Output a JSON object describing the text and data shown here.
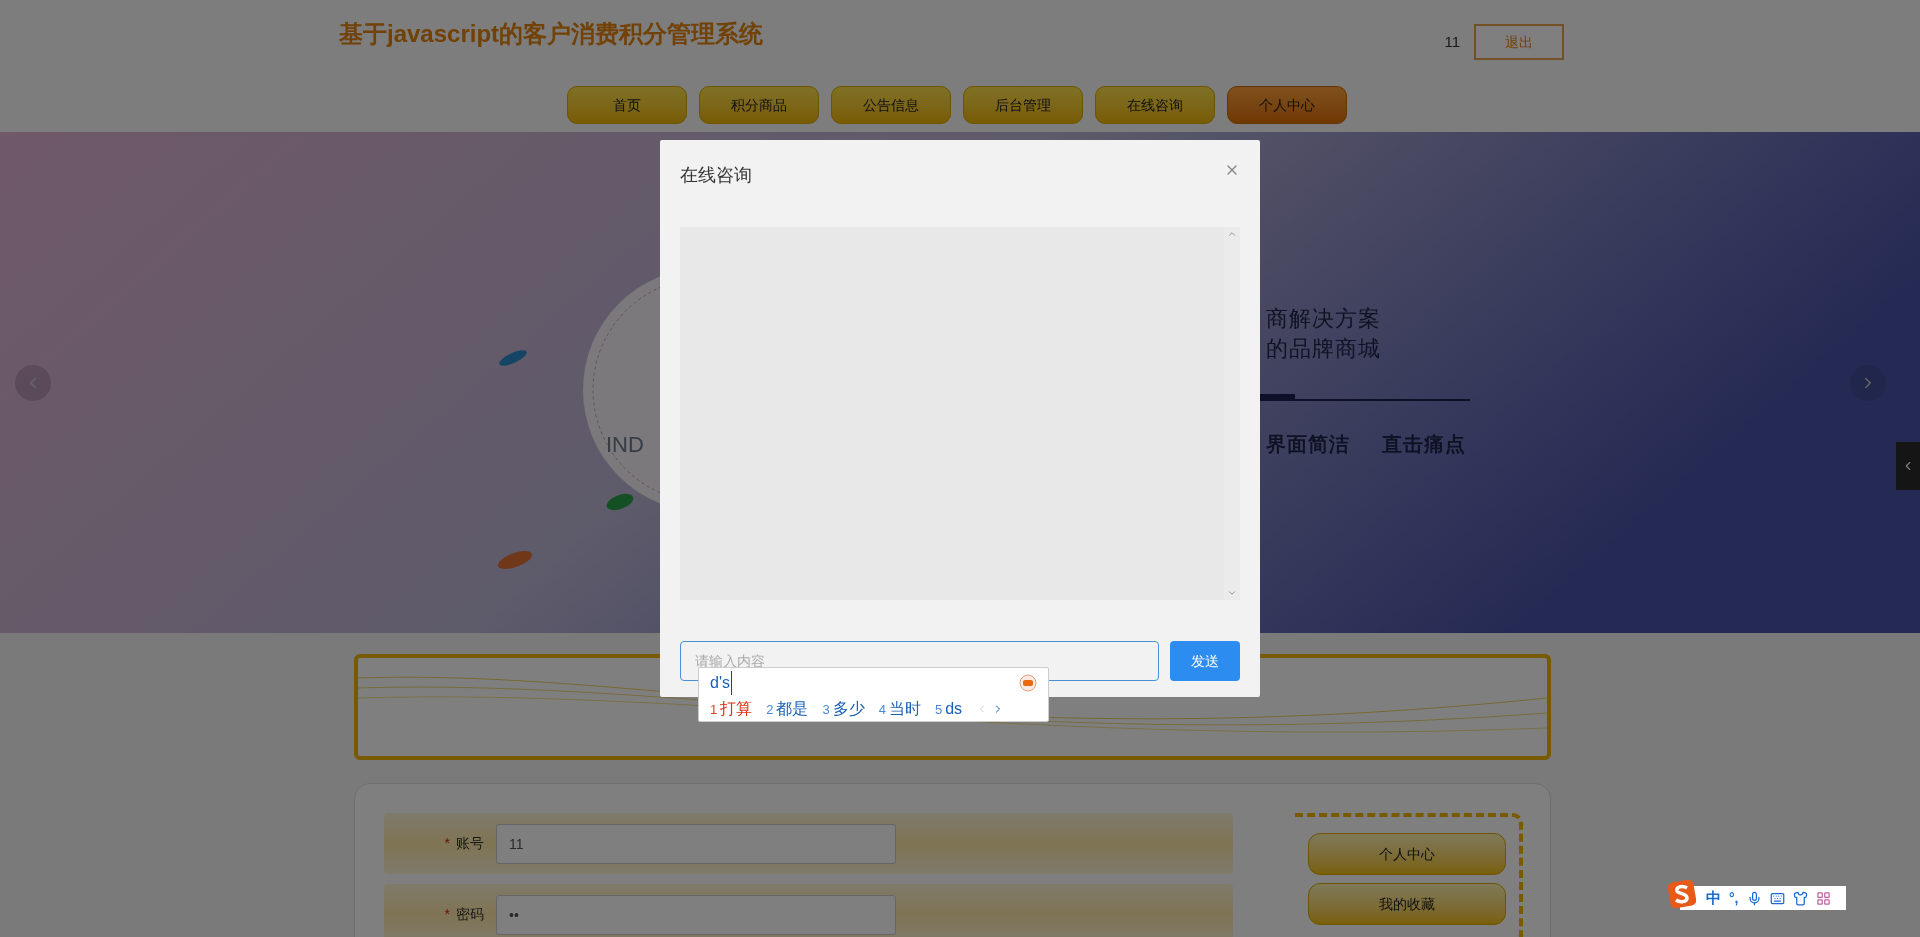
{
  "header": {
    "title": "基于javascript的客户消费积分管理系统",
    "user": "11",
    "logout": "退出"
  },
  "nav": [
    {
      "label": "首页",
      "selected": false
    },
    {
      "label": "积分商品",
      "selected": false
    },
    {
      "label": "公告信息",
      "selected": false
    },
    {
      "label": "后台管理",
      "selected": false
    },
    {
      "label": "在线咨询",
      "selected": false
    },
    {
      "label": "个人中心",
      "selected": true
    }
  ],
  "banner": {
    "letters": "IND",
    "lines": [
      "商解决方案",
      "的品牌商城"
    ],
    "tags": [
      "界面简洁",
      "直击痛点"
    ]
  },
  "form": {
    "fields": [
      {
        "marker": "*",
        "label": "账号",
        "value": "11"
      },
      {
        "marker": "*",
        "label": "密码",
        "value": "••"
      }
    ]
  },
  "side_menu": [
    "个人中心",
    "我的收藏"
  ],
  "dialog": {
    "title": "在线咨询",
    "input": {
      "placeholder": "请输入内容"
    },
    "send": "发送"
  },
  "ime": {
    "composition": "d's",
    "candidates": [
      {
        "index": "1",
        "text": "打算",
        "selected": true
      },
      {
        "index": "2",
        "text": "都是",
        "selected": false
      },
      {
        "index": "3",
        "text": "多少",
        "selected": false
      },
      {
        "index": "4",
        "text": "当时",
        "selected": false
      },
      {
        "index": "5",
        "text": "ds",
        "selected": false
      }
    ]
  },
  "ime_toolbar": {
    "mode": "中",
    "punctuation": "°,"
  }
}
